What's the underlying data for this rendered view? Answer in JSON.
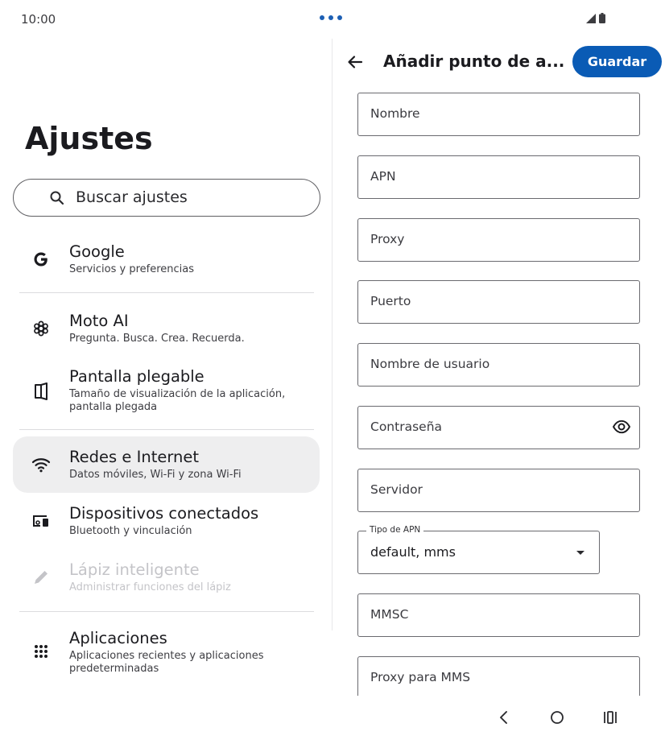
{
  "status": {
    "time": "10:00"
  },
  "left": {
    "title": "Ajustes",
    "search_placeholder": "Buscar ajustes",
    "items": [
      {
        "title": "Google",
        "subtitle": "Servicios y preferencias",
        "icon": "google-g-icon"
      },
      {
        "title": "Moto AI",
        "subtitle": "Pregunta. Busca. Crea. Recuerda.",
        "icon": "sparkle-icon"
      },
      {
        "title": "Pantalla plegable",
        "subtitle": "Tamaño de visualización de la aplicación, pantalla plegada",
        "icon": "foldable-icon"
      },
      {
        "title": "Redes e Internet",
        "subtitle": "Datos móviles, Wi-Fi y zona Wi-Fi",
        "icon": "wifi-icon"
      },
      {
        "title": "Dispositivos conectados",
        "subtitle": "Bluetooth y vinculación",
        "icon": "devices-icon"
      },
      {
        "title": "Lápiz inteligente",
        "subtitle": "Administrar funciones del lápiz",
        "icon": "pen-icon"
      },
      {
        "title": "Aplicaciones",
        "subtitle": "Aplicaciones recientes y aplicaciones predeterminadas",
        "icon": "apps-grid-icon"
      }
    ]
  },
  "right": {
    "title": "Añadir punto de a...",
    "save_label": "Guardar",
    "fields": [
      "Nombre",
      "APN",
      "Proxy",
      "Puerto",
      "Nombre de usuario",
      "Contraseña",
      "Servidor"
    ],
    "apn_type": {
      "label": "Tipo de APN",
      "value": "default, mms"
    },
    "fields_after": [
      "MMSC",
      "Proxy para MMS"
    ]
  },
  "colors": {
    "accent": "#0a5bb5",
    "active_bg": "#eeeeef"
  }
}
